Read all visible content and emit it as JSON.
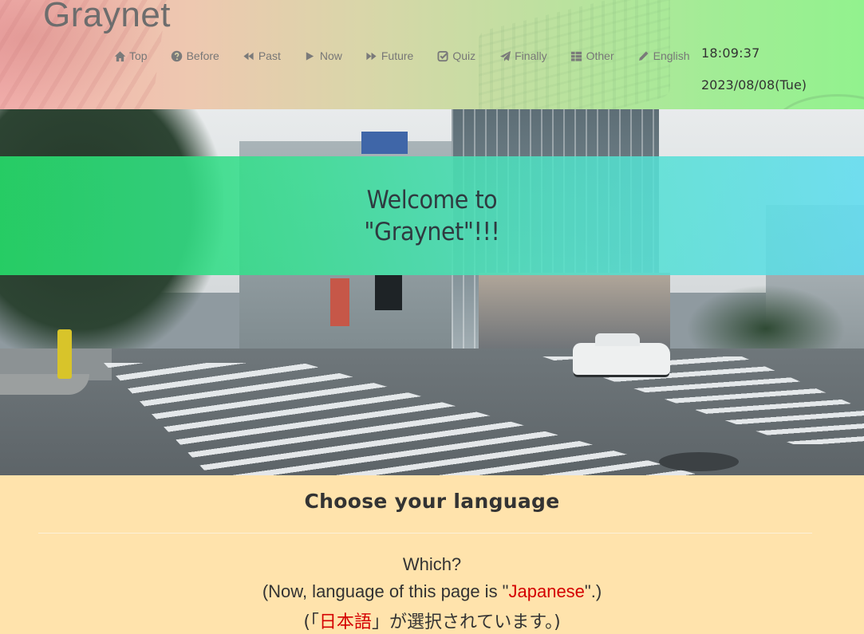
{
  "header": {
    "site_title": "Graynet",
    "nav": [
      {
        "label": "Top",
        "icon": "home-icon"
      },
      {
        "label": "Before",
        "icon": "question-circle-icon"
      },
      {
        "label": "Past",
        "icon": "backward-icon"
      },
      {
        "label": "Now",
        "icon": "play-icon"
      },
      {
        "label": "Future",
        "icon": "forward-icon"
      },
      {
        "label": "Quiz",
        "icon": "check-square-icon"
      },
      {
        "label": "Finally",
        "icon": "paper-plane-icon"
      },
      {
        "label": "Other",
        "icon": "grid-icon"
      },
      {
        "label": "English",
        "icon": "pencil-icon"
      }
    ],
    "clock": "18:09:37",
    "date": "2023/08/08(Tue)"
  },
  "hero": {
    "welcome_line1": "Welcome to",
    "welcome_line2": "\"Graynet\"!!!"
  },
  "language": {
    "heading": "Choose your language",
    "which": "Which?",
    "now_prefix": "(Now, language of this page is \"",
    "now_value": "Japanese",
    "now_suffix": "\".)",
    "ja_prefix": "(「",
    "ja_value": "日本語",
    "ja_suffix": "」が選択されています。)"
  },
  "colors": {
    "accent": "#d40000",
    "header_left": "#f2b0ad",
    "header_right": "#92f28e",
    "band_left": "#26d668",
    "band_right": "#60dcf0",
    "section_bg": "#ffe3ac"
  }
}
